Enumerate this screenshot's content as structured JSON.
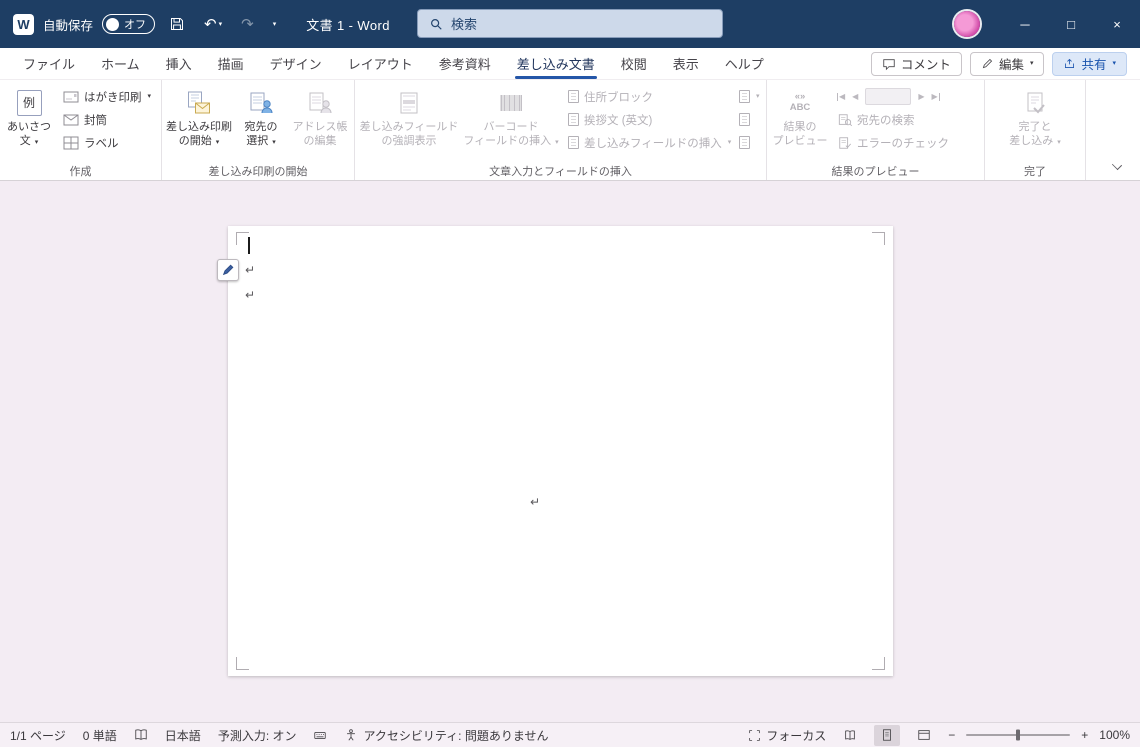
{
  "titlebar": {
    "autosave_label": "自動保存",
    "autosave_state": "オフ",
    "doc_title": "文書 1 - Word",
    "search_placeholder": "検索"
  },
  "tabs": {
    "items": [
      {
        "label": "ファイル"
      },
      {
        "label": "ホーム"
      },
      {
        "label": "挿入"
      },
      {
        "label": "描画"
      },
      {
        "label": "デザイン"
      },
      {
        "label": "レイアウト"
      },
      {
        "label": "参考資料"
      },
      {
        "label": "差し込み文書"
      },
      {
        "label": "校閲"
      },
      {
        "label": "表示"
      },
      {
        "label": "ヘルプ"
      }
    ],
    "comments": "コメント",
    "editing": "編集",
    "share": "共有"
  },
  "ribbon": {
    "create": {
      "group_label": "作成",
      "greeting_line1": "あいさつ",
      "greeting_line2": "文",
      "greeting_icon_text": "例",
      "postcard": "はがき印刷",
      "envelope": "封筒",
      "label_btn": "ラベル"
    },
    "start": {
      "group_label": "差し込み印刷の開始",
      "start1": "差し込み印刷",
      "start2": "の開始",
      "select1": "宛先の",
      "select2": "選択",
      "editlist1": "アドレス帳",
      "editlist2": "の編集"
    },
    "fields": {
      "group_label": "文章入力とフィールドの挿入",
      "highlight1": "差し込みフィールド",
      "highlight2": "の強調表示",
      "barcode1": "バーコード",
      "barcode2": "フィールドの挿入",
      "address_block": "住所ブロック",
      "greeting_en": "挨拶文 (英文)",
      "insert_field": "差し込みフィールドの挿入"
    },
    "preview": {
      "group_label": "結果のプレビュー",
      "preview1": "結果の",
      "preview2": "プレビュー",
      "icon_guillemets": "«»",
      "icon_abc": "ABC",
      "find_recipient": "宛先の検索",
      "check_errors": "エラーのチェック"
    },
    "finish": {
      "group_label": "完了",
      "finish1": "完了と",
      "finish2": "差し込み"
    }
  },
  "doc": {
    "paragraph_mark": "↵"
  },
  "statusbar": {
    "page_info": "1/1 ページ",
    "word_count": "0 単語",
    "language": "日本語",
    "prediction": "予測入力: オン",
    "accessibility": "アクセシビリティ: 問題ありません",
    "focus": "フォーカス",
    "zoom_level": "100%"
  },
  "glyphs": {
    "word_logo": "W",
    "dropdown": "▾",
    "undo": "↶",
    "redo": "↷",
    "minimize": "─",
    "maximize": "□",
    "close": "×",
    "nav_prev": "◀",
    "nav_next": "▶",
    "zoom_out": "−",
    "zoom_in": "+"
  },
  "colors": {
    "titlebar": "#1e3e64",
    "accent_blue": "#2456a8",
    "doc_background": "#f3ecf3"
  }
}
